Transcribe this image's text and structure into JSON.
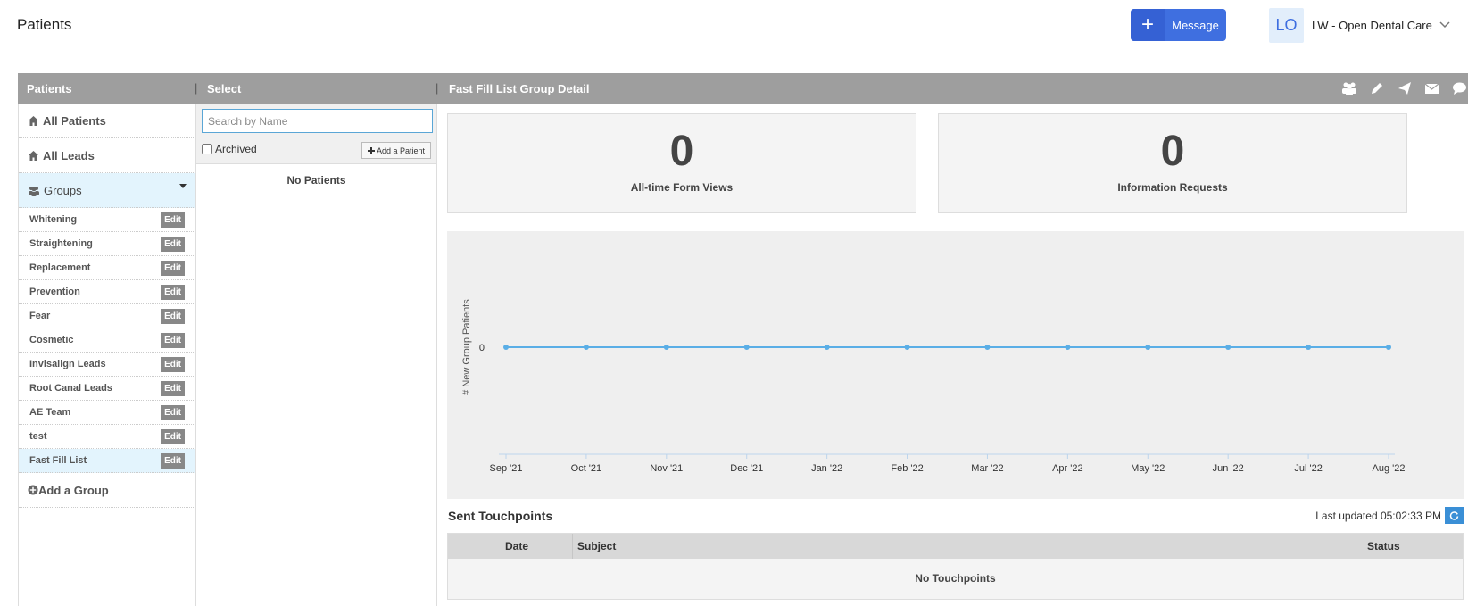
{
  "header": {
    "title": "Patients",
    "message_button_label": "Message",
    "avatar_initials": "LO",
    "account_name": "LW - Open Dental Care"
  },
  "panel_headers": {
    "patients": "Patients",
    "select": "Select",
    "detail": "Fast Fill List Group Detail"
  },
  "toolbar_icons": [
    "users-icon",
    "pencil-icon",
    "send-icon",
    "envelope-icon",
    "comment-icon"
  ],
  "sidebar": {
    "all_patients": "All Patients",
    "all_leads": "All Leads",
    "groups": "Groups",
    "edit_label": "Edit",
    "group_items": [
      {
        "label": "Whitening"
      },
      {
        "label": "Straightening"
      },
      {
        "label": "Replacement"
      },
      {
        "label": "Prevention"
      },
      {
        "label": "Fear"
      },
      {
        "label": "Cosmetic"
      },
      {
        "label": "Invisalign Leads"
      },
      {
        "label": "Root Canal Leads"
      },
      {
        "label": "AE Team"
      },
      {
        "label": "test"
      },
      {
        "label": "Fast Fill List"
      }
    ],
    "active_group": "Fast Fill List",
    "add_group": "Add a Group"
  },
  "select": {
    "search_placeholder": "Search by Name",
    "archived_label": "Archived",
    "add_patient_label": "Add a Patient",
    "empty_text": "No Patients"
  },
  "stats": {
    "form_views_value": "0",
    "form_views_label": "All-time Form Views",
    "info_requests_value": "0",
    "info_requests_label": "Information Requests"
  },
  "chart_data": {
    "type": "line",
    "categories": [
      "Sep '21",
      "Oct '21",
      "Nov '21",
      "Dec '21",
      "Jan '22",
      "Feb '22",
      "Mar '22",
      "Apr '22",
      "May '22",
      "Jun '22",
      "Jul '22",
      "Aug '22"
    ],
    "series": [
      {
        "values": [
          0,
          0,
          0,
          0,
          0,
          0,
          0,
          0,
          0,
          0,
          0,
          0
        ]
      }
    ],
    "ylabel": "# New Group Patients",
    "y_ticks": [
      "0"
    ],
    "grid": false,
    "line_color": "#5aaee6"
  },
  "touchpoints": {
    "title": "Sent Touchpoints",
    "last_updated": "Last updated 05:02:33 PM",
    "columns": {
      "date": "Date",
      "subject": "Subject",
      "status": "Status"
    },
    "empty_text": "No Touchpoints"
  },
  "colors": {
    "primary": "#3f6fe0",
    "panel_header": "#9e9e9e",
    "active_bg": "#e3f4fd",
    "edit_button": "#888888"
  }
}
